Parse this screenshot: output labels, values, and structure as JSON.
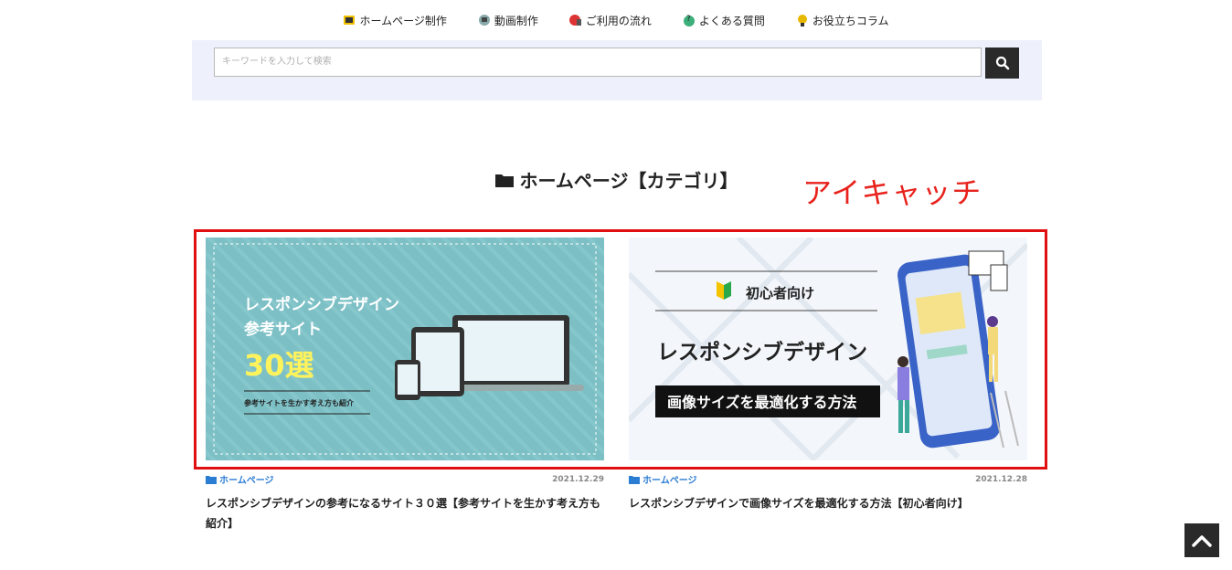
{
  "nav": {
    "items": [
      {
        "label": "ホームページ制作",
        "icon": "homepage-icon"
      },
      {
        "label": "動画制作",
        "icon": "video-icon"
      },
      {
        "label": "ご利用の流れ",
        "icon": "flow-icon"
      },
      {
        "label": "よくある質問",
        "icon": "faq-icon"
      },
      {
        "label": "お役立ちコラム",
        "icon": "column-icon"
      }
    ]
  },
  "search": {
    "placeholder": "キーワードを入力して検索",
    "button_icon": "search-icon"
  },
  "category": {
    "heading": "ホームページ【カテゴリ】",
    "icon": "folder-icon"
  },
  "annotation": {
    "text": "アイキャッチ",
    "color": "#e8221c"
  },
  "posts": [
    {
      "category": "ホームページ",
      "date": "2021.12.29",
      "title": "レスポンシブデザインの参考になるサイト３０選【参考サイトを生かす考え方も紹介】",
      "thumb": {
        "line1": "レスポンシブデザイン",
        "line2": "参考サイト",
        "line3": "30選",
        "line4": "参考サイトを生かす考え方も紹介",
        "bg": "#7cc0c6",
        "accent": "#fff35c"
      }
    },
    {
      "category": "ホームページ",
      "date": "2021.12.28",
      "title": "レスポンシブデザインで画像サイズを最適化する方法【初心者向け】",
      "thumb": {
        "badge": "初心者向け",
        "line1": "レスポンシブデザイン",
        "line2": "画像サイズを最適化する方法"
      }
    }
  ],
  "back_to_top_icon": "chevron-up-icon"
}
